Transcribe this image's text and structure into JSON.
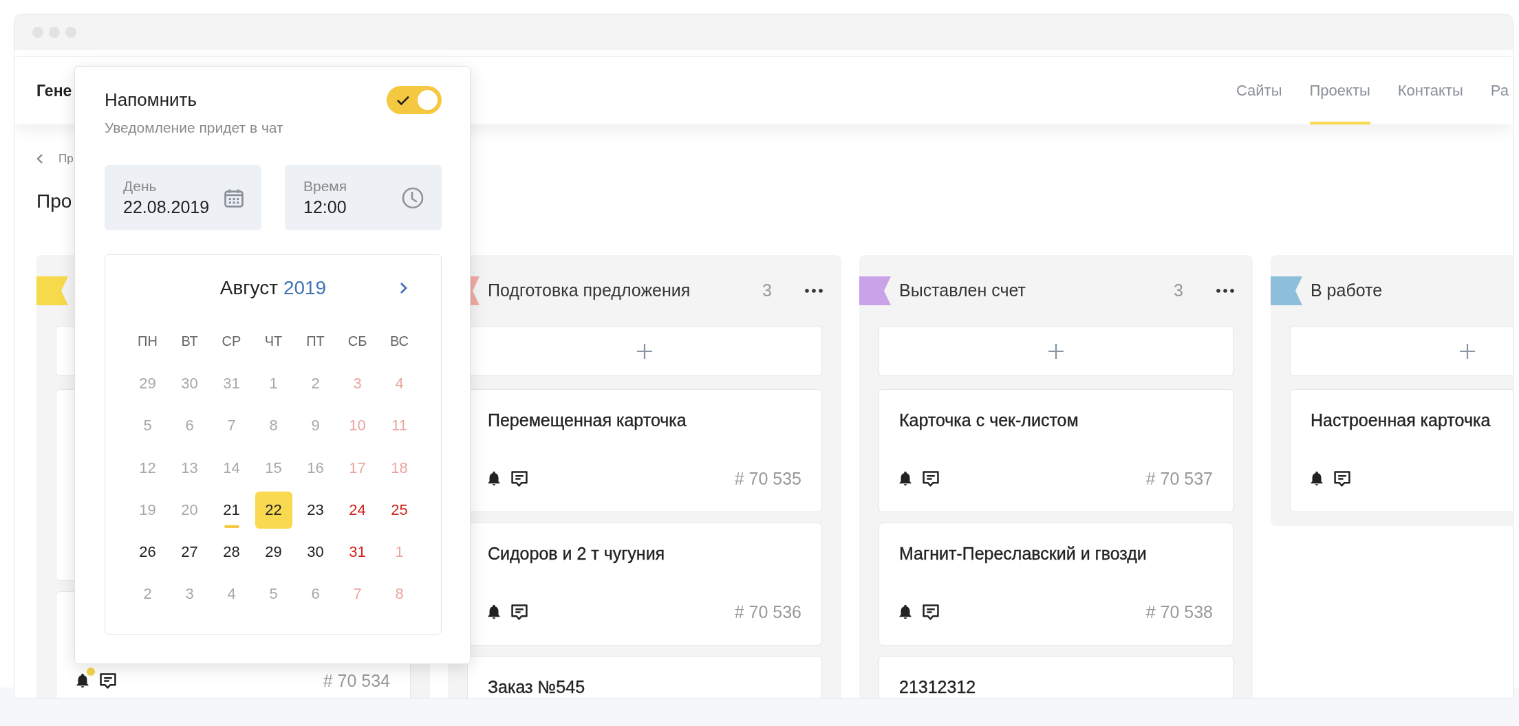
{
  "header": {
    "title": "Гене",
    "nav": [
      {
        "label": "Сайты",
        "selected": false
      },
      {
        "label": "Проекты",
        "selected": true
      },
      {
        "label": "Контакты",
        "selected": false
      },
      {
        "label": "Ра",
        "selected": false
      }
    ]
  },
  "breadcrumb": {
    "label": "Пр"
  },
  "page_title": "Про",
  "board": {
    "columns": [
      {
        "color": "#f7d94c",
        "more_menu": false,
        "cards": [
          {
            "kind": "covered"
          },
          {
            "kind": "task",
            "icons": true,
            "reminder_dot": true,
            "number": "# 70 534"
          }
        ]
      },
      {
        "color": "#f2aaa5",
        "title": "Подготовка предложения",
        "count": "3",
        "more_menu": true,
        "cards": [
          {
            "kind": "task",
            "title": "Перемещенная карточка",
            "icons": true,
            "reminder_dot": false,
            "number": "# 70 535"
          },
          {
            "kind": "task",
            "title": "Сидоров и 2 т чугуния",
            "icons": true,
            "reminder_dot": false,
            "number": "# 70 536"
          },
          {
            "kind": "task",
            "title": "Заказ №545",
            "icons": false,
            "reminder_dot": false
          }
        ]
      },
      {
        "color": "#c9a2e8",
        "title": "Выставлен счет",
        "count": "3",
        "more_menu": true,
        "cards": [
          {
            "kind": "task",
            "title": "Карточка с чек-листом",
            "icons": true,
            "reminder_dot": false,
            "number": "# 70 537"
          },
          {
            "kind": "task",
            "title": "Магнит-Переславский и гвозди",
            "icons": true,
            "reminder_dot": false,
            "number": "# 70 538"
          },
          {
            "kind": "task",
            "title": "21312312",
            "icons": false,
            "reminder_dot": false
          }
        ]
      },
      {
        "color": "#8dbfdb",
        "title": "В работе",
        "more_menu": false,
        "cards": [
          {
            "kind": "task",
            "title": "Настроенная карточка",
            "icons": true,
            "reminder_dot": false
          }
        ]
      }
    ]
  },
  "reminder": {
    "title": "Напомнить",
    "subtitle": "Уведомление придет в чат",
    "on": true,
    "day": {
      "label": "День",
      "value": "22.08.2019"
    },
    "time": {
      "label": "Время",
      "value": "12:00"
    },
    "calendar": {
      "month": "Август",
      "year": "2019",
      "weekdays": [
        "ПН",
        "ВТ",
        "СР",
        "ЧТ",
        "ПТ",
        "СБ",
        "ВС"
      ],
      "weeks": [
        [
          {
            "d": "29",
            "muted": true,
            "weekend": false,
            "selected": false,
            "today": false
          },
          {
            "d": "30",
            "muted": true,
            "weekend": false,
            "selected": false,
            "today": false
          },
          {
            "d": "31",
            "muted": true,
            "weekend": false,
            "selected": false,
            "today": false
          },
          {
            "d": "1",
            "muted": true,
            "weekend": false,
            "selected": false,
            "today": false
          },
          {
            "d": "2",
            "muted": true,
            "weekend": false,
            "selected": false,
            "today": false
          },
          {
            "d": "3",
            "muted": true,
            "weekend": true,
            "selected": false,
            "today": false
          },
          {
            "d": "4",
            "muted": true,
            "weekend": true,
            "selected": false,
            "today": false
          }
        ],
        [
          {
            "d": "5",
            "muted": true,
            "weekend": false,
            "selected": false,
            "today": false
          },
          {
            "d": "6",
            "muted": true,
            "weekend": false,
            "selected": false,
            "today": false
          },
          {
            "d": "7",
            "muted": true,
            "weekend": false,
            "selected": false,
            "today": false
          },
          {
            "d": "8",
            "muted": true,
            "weekend": false,
            "selected": false,
            "today": false
          },
          {
            "d": "9",
            "muted": true,
            "weekend": false,
            "selected": false,
            "today": false
          },
          {
            "d": "10",
            "muted": true,
            "weekend": true,
            "selected": false,
            "today": false
          },
          {
            "d": "11",
            "muted": true,
            "weekend": true,
            "selected": false,
            "today": false
          }
        ],
        [
          {
            "d": "12",
            "muted": true,
            "weekend": false,
            "selected": false,
            "today": false
          },
          {
            "d": "13",
            "muted": true,
            "weekend": false,
            "selected": false,
            "today": false
          },
          {
            "d": "14",
            "muted": true,
            "weekend": false,
            "selected": false,
            "today": false
          },
          {
            "d": "15",
            "muted": true,
            "weekend": false,
            "selected": false,
            "today": false
          },
          {
            "d": "16",
            "muted": true,
            "weekend": false,
            "selected": false,
            "today": false
          },
          {
            "d": "17",
            "muted": true,
            "weekend": true,
            "selected": false,
            "today": false
          },
          {
            "d": "18",
            "muted": true,
            "weekend": true,
            "selected": false,
            "today": false
          }
        ],
        [
          {
            "d": "19",
            "muted": true,
            "weekend": false,
            "selected": false,
            "today": false
          },
          {
            "d": "20",
            "muted": true,
            "weekend": false,
            "selected": false,
            "today": false
          },
          {
            "d": "21",
            "muted": false,
            "weekend": false,
            "selected": false,
            "today": true
          },
          {
            "d": "22",
            "muted": false,
            "weekend": false,
            "selected": true,
            "today": false
          },
          {
            "d": "23",
            "muted": false,
            "weekend": false,
            "selected": false,
            "today": false
          },
          {
            "d": "24",
            "muted": false,
            "weekend": true,
            "selected": false,
            "today": false
          },
          {
            "d": "25",
            "muted": false,
            "weekend": true,
            "selected": false,
            "today": false
          }
        ],
        [
          {
            "d": "26",
            "muted": false,
            "weekend": false,
            "selected": false,
            "today": false
          },
          {
            "d": "27",
            "muted": false,
            "weekend": false,
            "selected": false,
            "today": false
          },
          {
            "d": "28",
            "muted": false,
            "weekend": false,
            "selected": false,
            "today": false
          },
          {
            "d": "29",
            "muted": false,
            "weekend": false,
            "selected": false,
            "today": false
          },
          {
            "d": "30",
            "muted": false,
            "weekend": false,
            "selected": false,
            "today": false
          },
          {
            "d": "31",
            "muted": false,
            "weekend": true,
            "selected": false,
            "today": false
          },
          {
            "d": "1",
            "muted": true,
            "weekend": true,
            "selected": false,
            "today": false
          }
        ],
        [
          {
            "d": "2",
            "muted": true,
            "weekend": false,
            "selected": false,
            "today": false
          },
          {
            "d": "3",
            "muted": true,
            "weekend": false,
            "selected": false,
            "today": false
          },
          {
            "d": "4",
            "muted": true,
            "weekend": false,
            "selected": false,
            "today": false
          },
          {
            "d": "5",
            "muted": true,
            "weekend": false,
            "selected": false,
            "today": false
          },
          {
            "d": "6",
            "muted": true,
            "weekend": false,
            "selected": false,
            "today": false
          },
          {
            "d": "7",
            "muted": true,
            "weekend": true,
            "selected": false,
            "today": false
          },
          {
            "d": "8",
            "muted": true,
            "weekend": true,
            "selected": false,
            "today": false
          }
        ]
      ]
    }
  }
}
